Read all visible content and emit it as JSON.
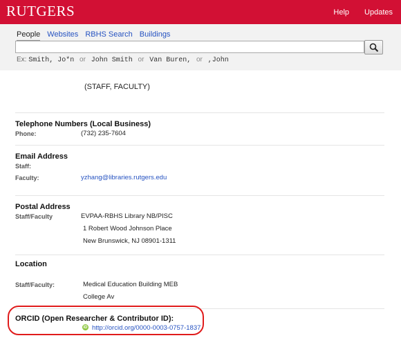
{
  "header": {
    "logo": "RUTGERS",
    "nav": [
      "Help",
      "Updates"
    ],
    "brand_color": "#d21034"
  },
  "search": {
    "tabs": [
      "People",
      "Websites",
      "RBHS Search",
      "Buildings"
    ],
    "active_tab": "People",
    "input_value": "",
    "hint": {
      "prefix": "Ex:",
      "examples": [
        "Smith, Jo*n",
        "John Smith",
        "Van Buren,",
        ",John"
      ],
      "separator": "or"
    }
  },
  "profile": {
    "title": "(STAFF, FACULTY)",
    "telephone": {
      "heading": "Telephone Numbers (Local Business)",
      "label": "Phone:",
      "value": "(732) 235-7604"
    },
    "email": {
      "heading": "Email Address",
      "staff_label": "Staff:",
      "faculty_label": "Faculty:",
      "faculty_value": "yzhang@libraries.rutgers.edu"
    },
    "postal": {
      "heading": "Postal Address",
      "label": "Staff/Faculty",
      "lines": [
        "EVPAA-RBHS Library NB/PISC",
        "1 Robert Wood Johnson Place",
        "New Brunswick, NJ  08901-1311"
      ]
    },
    "location": {
      "heading": "Location",
      "label": "Staff/Faculty:",
      "lines": [
        "Medical Education Building MEB",
        "College Av"
      ]
    },
    "orcid": {
      "heading": "ORCID (Open Researcher & Contributor ID):",
      "badge": "iD",
      "link": "http://orcid.org/0000-0003-0757-1837"
    }
  }
}
